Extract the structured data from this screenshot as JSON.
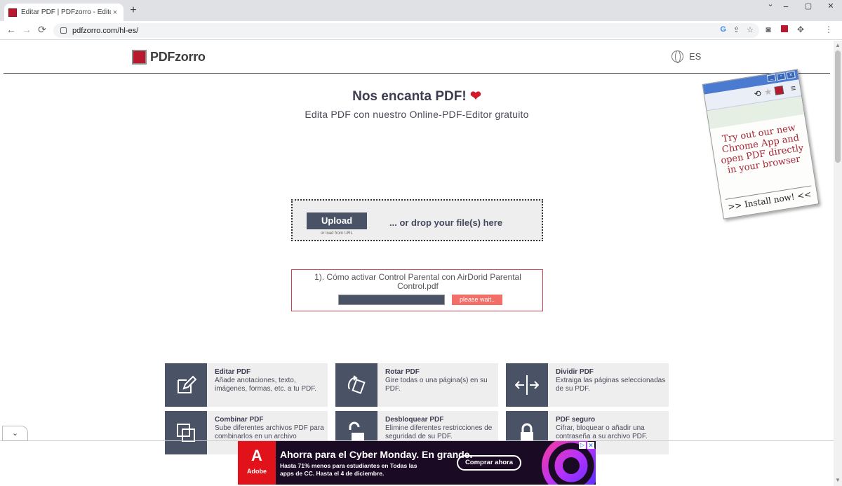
{
  "browser": {
    "tab_title": "Editar PDF | PDFzorro - Editor de",
    "tab_close": "×",
    "new_tab": "+",
    "url": "pdfzorro.com/hl-es/",
    "win_minimize": "−",
    "win_maximize": "▢",
    "win_close": "✕",
    "back": "←",
    "forward": "→",
    "reload": "⟳"
  },
  "header": {
    "logo_text": "PDFzorro",
    "lang": "ES"
  },
  "hero": {
    "title": "Nos encanta PDF!",
    "heart": "❤",
    "subtitle": "Edita PDF con nuestro Online-PDF-Editor gratuito"
  },
  "promo": {
    "text": "Try out our new Chrome App and open PDF directly in your browser",
    "install": ">> Install now! <<"
  },
  "upload": {
    "button": "Upload",
    "url_link": "or load from URL",
    "drop_text": "... or drop your file(s) here"
  },
  "file": {
    "name": "1). Cómo activar Control Parental con AirDorid Parental Control.pdf",
    "status": "please wait.."
  },
  "tools": [
    {
      "title": "Editar PDF",
      "desc": "Añade anotaciones, texto, imágenes, formas, etc. a tu PDF."
    },
    {
      "title": "Rotar PDF",
      "desc": "Gire todas o una página(s) en su PDF."
    },
    {
      "title": "Dividir PDF",
      "desc": "Extraiga las páginas seleccionadas de su PDF."
    },
    {
      "title": "Combinar PDF",
      "desc": "Sube diferentes archivos PDF para combinarlos en un archivo"
    },
    {
      "title": "Desbloquear PDF",
      "desc": "Elimine diferentes restricciones de seguridad de su PDF."
    },
    {
      "title": "PDF seguro",
      "desc": "Cifrar, bloquear o añadir una contraseña a su archivo PDF."
    }
  ],
  "ad": {
    "brand": "Adobe",
    "title": "Ahorra para el Cyber Monday. En grande.",
    "desc": "Hasta 71% menos para estudiantes en Todas las apps de CC. Hasta el 4 de diciembre.",
    "button": "Comprar ahora"
  },
  "collapse_icon": "⌄",
  "colors": {
    "brand_red": "#b8192f",
    "slate": "#4a5266",
    "wait": "#f26f67"
  }
}
